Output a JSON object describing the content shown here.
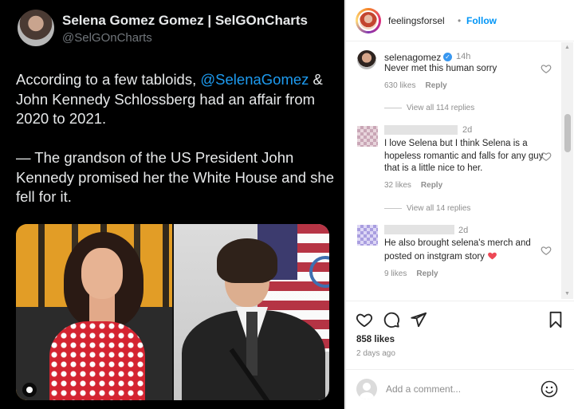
{
  "tweet": {
    "display_name": "Selena Gomez Gomez | SelGOnCharts",
    "handle": "@SelGOnCharts",
    "text_line1_prefix": "According to a few tabloids, ",
    "mention": "@SelenaGomez",
    "text_line1_suffix": " & John Kennedy Schlossberg had an affair from 2020 to 2021.",
    "text_para2": "— The grandson of the US President John Kennedy promised her the White House and she fell for it."
  },
  "instagram": {
    "header": {
      "username": "feelingsforsel",
      "separator": "•",
      "follow_label": "Follow",
      "more_label": "•••"
    },
    "comments": [
      {
        "username": "selenagomez",
        "verified": true,
        "time": "14h",
        "text": "Never met this human sorry",
        "likes": "630 likes",
        "reply": "Reply",
        "view_replies": "View all 114 replies"
      },
      {
        "username": "",
        "time": "2d",
        "text": "I love Selena but I think Selena is a hopeless romantic and falls for any guy that is a little nice to her.",
        "likes": "32 likes",
        "reply": "Reply",
        "view_replies": "View all 14 replies"
      },
      {
        "username": "",
        "time": "2d",
        "text": "He also brought selena's merch and posted on instgram story",
        "likes": "9 likes",
        "reply": "Reply"
      }
    ],
    "actions": {
      "like_icon": "heart-icon",
      "comment_icon": "comment-icon",
      "share_icon": "send-icon",
      "save_icon": "bookmark-icon",
      "likes": "858 likes",
      "posted": "2 days ago"
    },
    "add_comment": {
      "placeholder": "Add a comment...",
      "emoji_icon": "smiley-icon"
    }
  },
  "colors": {
    "tweet_bg": "#000000",
    "mention": "#1d9bf0",
    "follow": "#0095f6",
    "verified": "#3897f0",
    "heart_emoji": "#ed4956"
  }
}
